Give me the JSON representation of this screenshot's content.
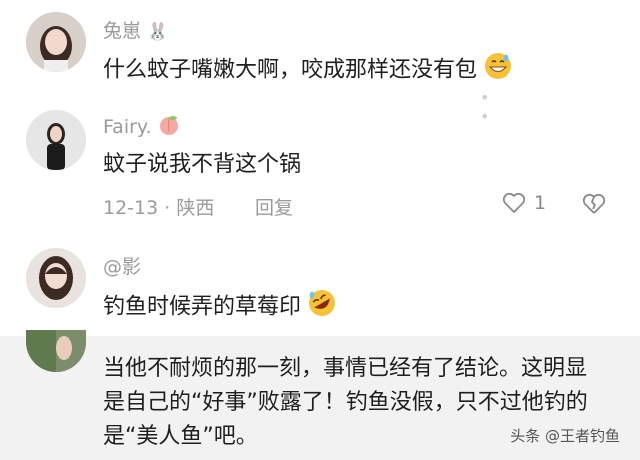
{
  "comments": [
    {
      "username": "兔崽",
      "text": "什么蚊子嘴嫩大啊，咬成那样还没有包",
      "avatar_icon": "avatar-girl-1",
      "emoji": "grin-sweat-emoji"
    },
    {
      "username": "Fairy.",
      "text": "蚊子说我不背这个锅",
      "date": "12-13",
      "separator": "·",
      "location": "陕西",
      "reply_label": "回复",
      "like_count": "1",
      "avatar_icon": "avatar-girl-2",
      "username_emoji": "peach-emoji"
    },
    {
      "username": "@影",
      "text": "钓鱼时候弄的草莓印",
      "avatar_icon": "avatar-girl-3",
      "emoji": "rofl-emoji"
    },
    {
      "avatar_icon": "avatar-girl-4",
      "text": "当他不耐烦的那一刻，事情已经有了结论。这明显是自己的“好事”败露了！钓鱼没假，只不过他钓的是“美人鱼”吧。"
    }
  ],
  "watermark": "头条 @王者钓鱼",
  "colors": {
    "meta_gray": "#9b9b9b",
    "overlay_bg": "#f2f2f2"
  }
}
